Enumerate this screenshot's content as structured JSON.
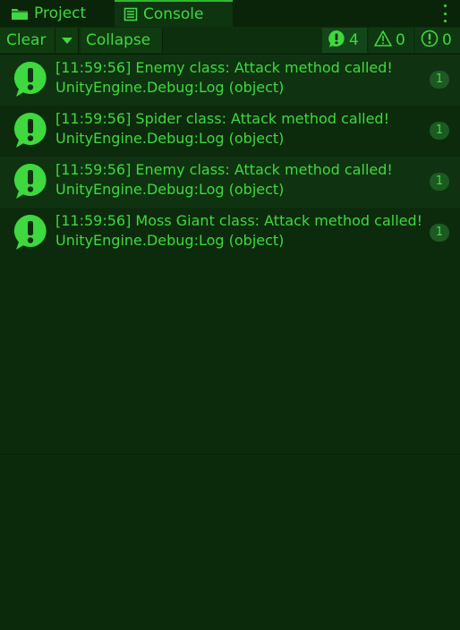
{
  "tabs": {
    "project_label": "Project",
    "console_label": "Console"
  },
  "toolbar": {
    "clear_label": "Clear",
    "collapse_label": "Collapse",
    "log_count": "4",
    "warning_count": "0",
    "error_count": "0"
  },
  "logs": [
    {
      "message": "[11:59:56] Enemy class: Attack method called!",
      "trace": "UnityEngine.Debug:Log (object)",
      "count": "1"
    },
    {
      "message": "[11:59:56] Spider class: Attack method called!",
      "trace": "UnityEngine.Debug:Log (object)",
      "count": "1"
    },
    {
      "message": "[11:59:56] Enemy class: Attack method called!",
      "trace": "UnityEngine.Debug:Log (object)",
      "count": "1"
    },
    {
      "message": "[11:59:56] Moss Giant class: Attack method called!",
      "trace": "UnityEngine.Debug:Log (object)",
      "count": "1"
    }
  ],
  "icons": {
    "project_tab": "folder-icon",
    "console_tab": "console-icon",
    "log_entry": "info-bubble-icon",
    "warning_filter": "warning-triangle-icon",
    "error_filter": "error-icon"
  },
  "colors": {
    "text": "#3fd83f",
    "background": "#0c2b0c",
    "icon": "#3fd83f"
  }
}
